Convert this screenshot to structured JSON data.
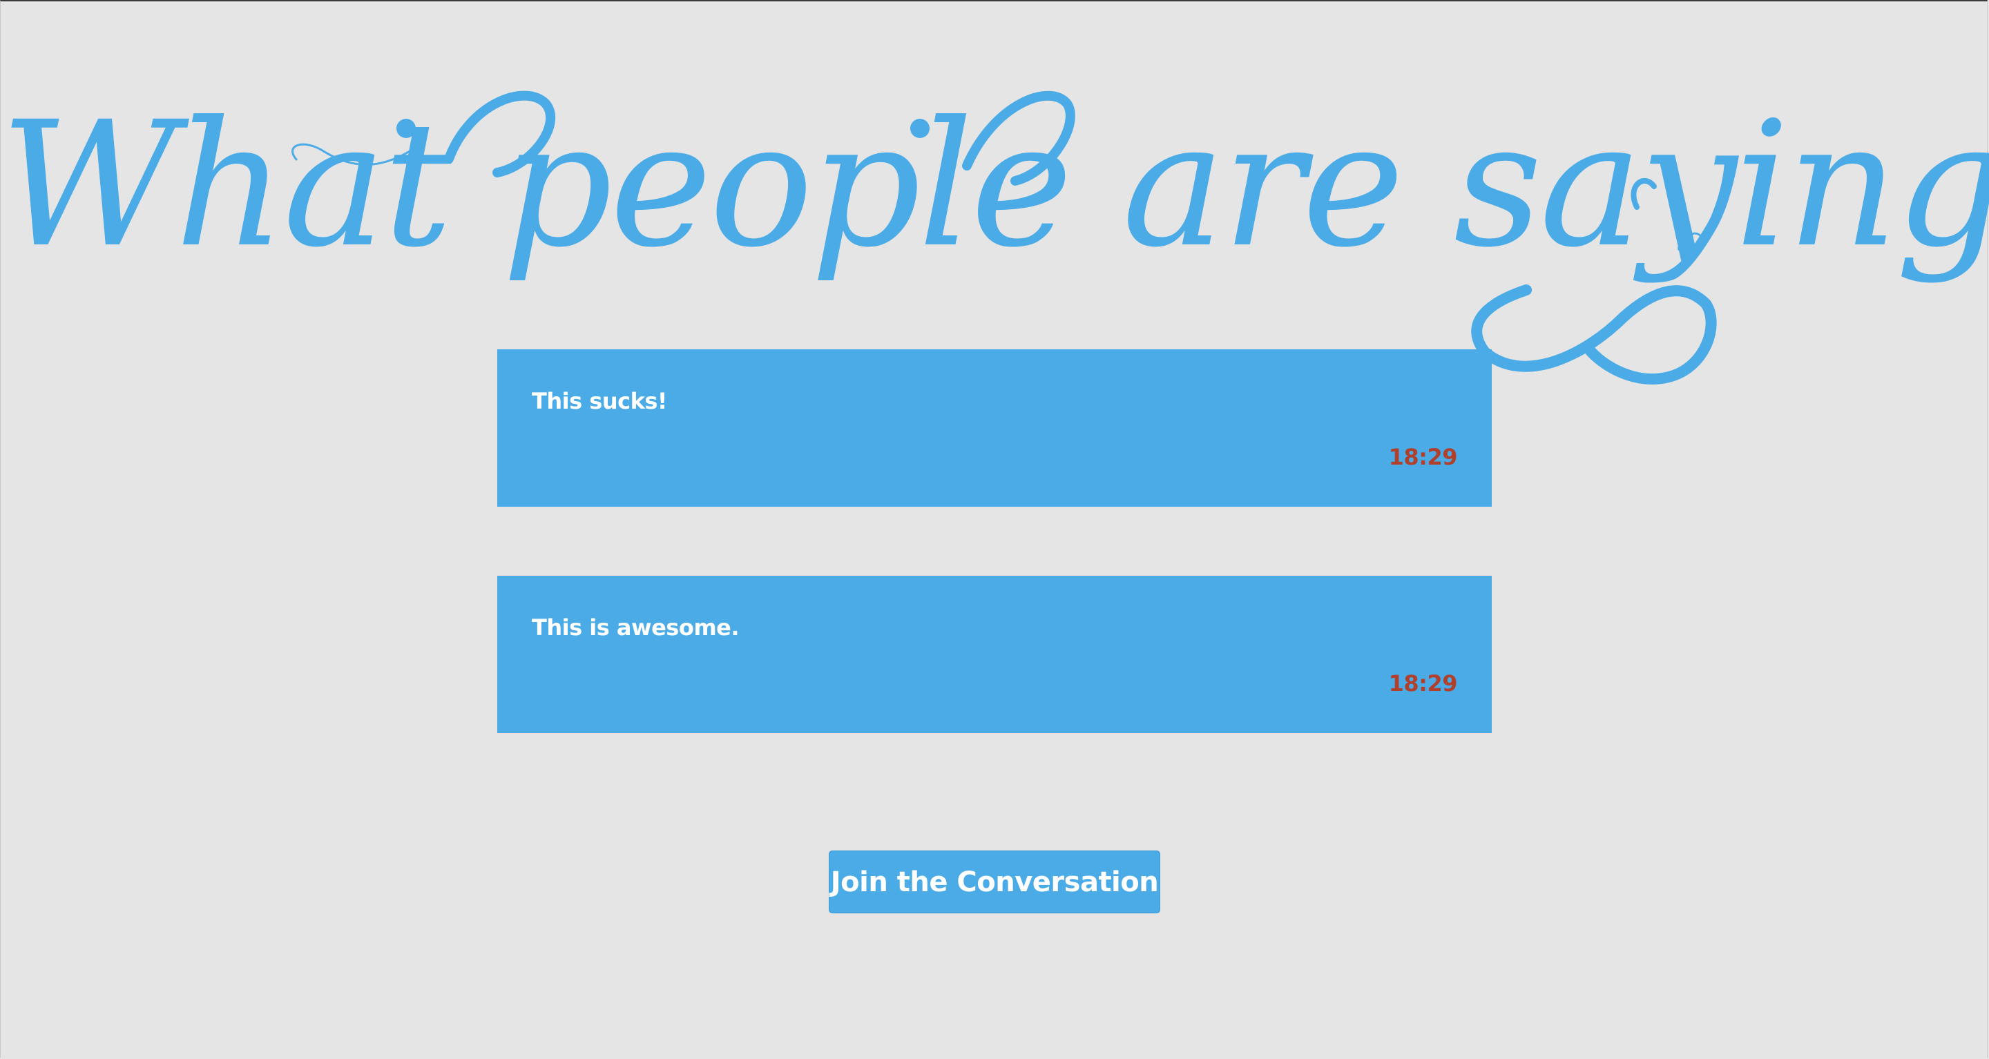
{
  "page": {
    "title": "What people are saying"
  },
  "comments": [
    {
      "text": "This sucks!",
      "time": "18:29"
    },
    {
      "text": "This is awesome.",
      "time": "18:29"
    }
  ],
  "actions": {
    "join_label": "Join the Conversation"
  },
  "colors": {
    "background": "#e5e5e5",
    "accent": "#4aabe7",
    "timestamp": "#b0402c",
    "text_on_accent": "#ffffff"
  }
}
